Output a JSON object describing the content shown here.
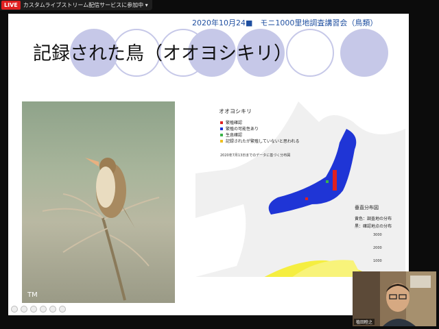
{
  "live_bar": {
    "badge": "LIVE",
    "text": "カスタムライブストリーム配信サービスに参加中 ▾"
  },
  "slide": {
    "header": "2020年10月24■　モニ1000里地調査講習会（鳥類）",
    "title": "記録された鳥（オオヨシキリ）",
    "photo_credit": "TM",
    "map": {
      "title": "オオヨシキリ",
      "legend": [
        {
          "label": "繁殖確認",
          "color": "#e02020"
        },
        {
          "label": "繁殖の可能性あり",
          "color": "#1f35d6"
        },
        {
          "label": "生息確認",
          "color": "#3cb44b"
        },
        {
          "label": "記録されたが繁殖していないと思われる",
          "color": "#f0c020"
        }
      ],
      "note": "2020年7月13日までのデータに基づく分布図",
      "vertical": {
        "title": "垂直分布図",
        "sub1": "黄色：調査地の分布",
        "sub2": "黒：確認地点の分布",
        "ticks": [
          "3000",
          "2000",
          "1000"
        ]
      }
    }
  },
  "webcam": {
    "name": "植田睦之"
  }
}
